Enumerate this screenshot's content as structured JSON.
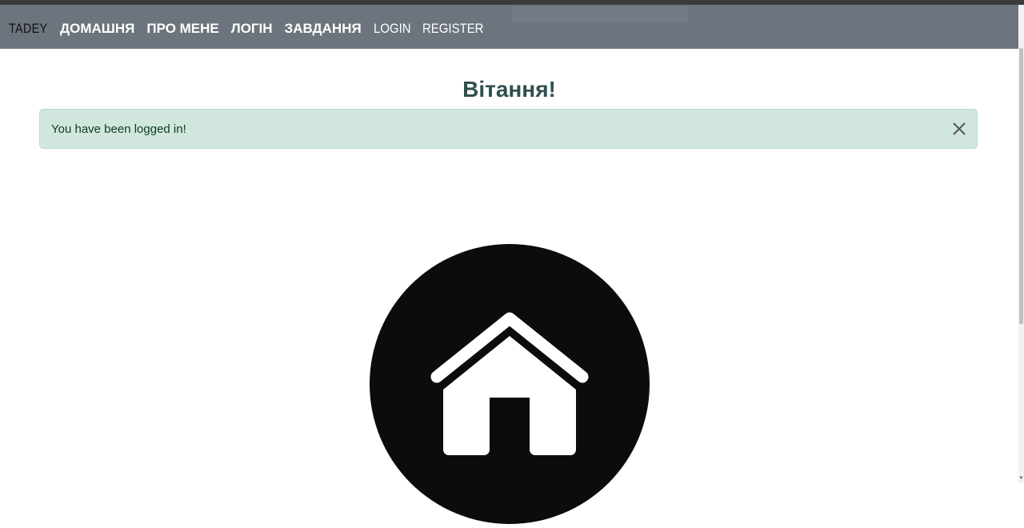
{
  "navbar": {
    "brand": "TADEY",
    "links": [
      {
        "label": "ДОМАШНЯ"
      },
      {
        "label": "ПРО МЕНЕ"
      },
      {
        "label": "ЛОГІН"
      },
      {
        "label": "ЗАВДАННЯ"
      },
      {
        "label": "LOGIN"
      },
      {
        "label": "REGISTER"
      }
    ],
    "background_color": "#6c757d"
  },
  "main": {
    "title": "Вітання!",
    "alert": {
      "message": "You have been logged in!",
      "background_color": "#d1e7dd",
      "close_icon": "close-icon"
    },
    "home_icon": "home-icon"
  }
}
